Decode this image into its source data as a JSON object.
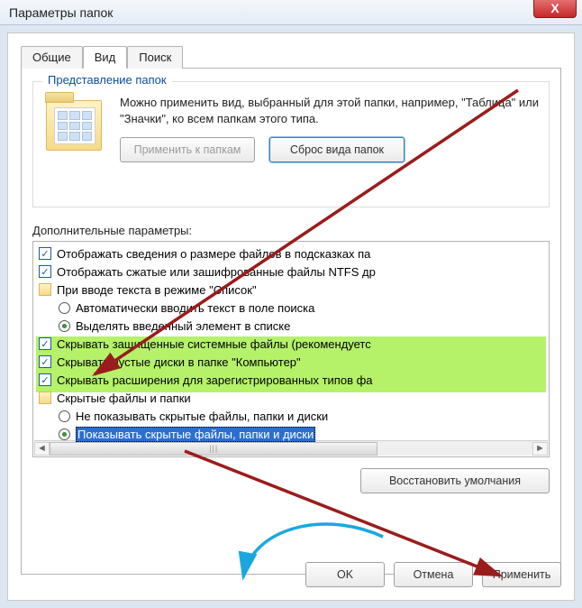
{
  "window": {
    "title": "Параметры папок",
    "close_glyph": "X"
  },
  "tabs": {
    "general": "Общие",
    "view": "Вид",
    "search": "Поиск"
  },
  "folderview": {
    "group_title": "Представление папок",
    "description": "Можно применить вид, выбранный для этой папки, например, \"Таблица\" или \"Значки\", ко всем папкам этого типа.",
    "apply_btn": "Применить к папкам",
    "reset_btn": "Сброс вида папок"
  },
  "advanced": {
    "label": "Дополнительные параметры:",
    "items": [
      {
        "kind": "check",
        "checked": true,
        "indent": 0,
        "text": "Отображать сведения о размере файлов в подсказках па"
      },
      {
        "kind": "check",
        "checked": true,
        "indent": 0,
        "text": "Отображать сжатые или зашифрованные файлы NTFS др"
      },
      {
        "kind": "folder",
        "indent": 0,
        "text": "При вводе текста в режиме \"Список\""
      },
      {
        "kind": "radio",
        "selected": false,
        "indent": 1,
        "text": "Автоматически вводить текст в поле поиска"
      },
      {
        "kind": "radio",
        "selected": true,
        "indent": 1,
        "text": "Выделять введенный элемент в списке"
      },
      {
        "kind": "check",
        "checked": true,
        "indent": 0,
        "hl": true,
        "text": "Скрывать защищенные системные файлы (рекомендуетс"
      },
      {
        "kind": "check",
        "checked": true,
        "indent": 0,
        "hl": true,
        "text": "Скрывать пустые диски в папке \"Компьютер\""
      },
      {
        "kind": "check",
        "checked": true,
        "indent": 0,
        "hl": true,
        "text": "Скрывать расширения для зарегистрированных типов фа"
      },
      {
        "kind": "folder",
        "indent": 0,
        "text": "Скрытые файлы и папки"
      },
      {
        "kind": "radio",
        "selected": false,
        "indent": 1,
        "text": "Не показывать скрытые файлы, папки и диски"
      },
      {
        "kind": "radio",
        "selected": true,
        "indent": 1,
        "sel": true,
        "text": "Показывать скрытые файлы, папки и диски"
      }
    ],
    "restore_btn": "Восстановить умолчания"
  },
  "buttons": {
    "ok": "OK",
    "cancel": "Отмена",
    "apply": "Применить"
  }
}
